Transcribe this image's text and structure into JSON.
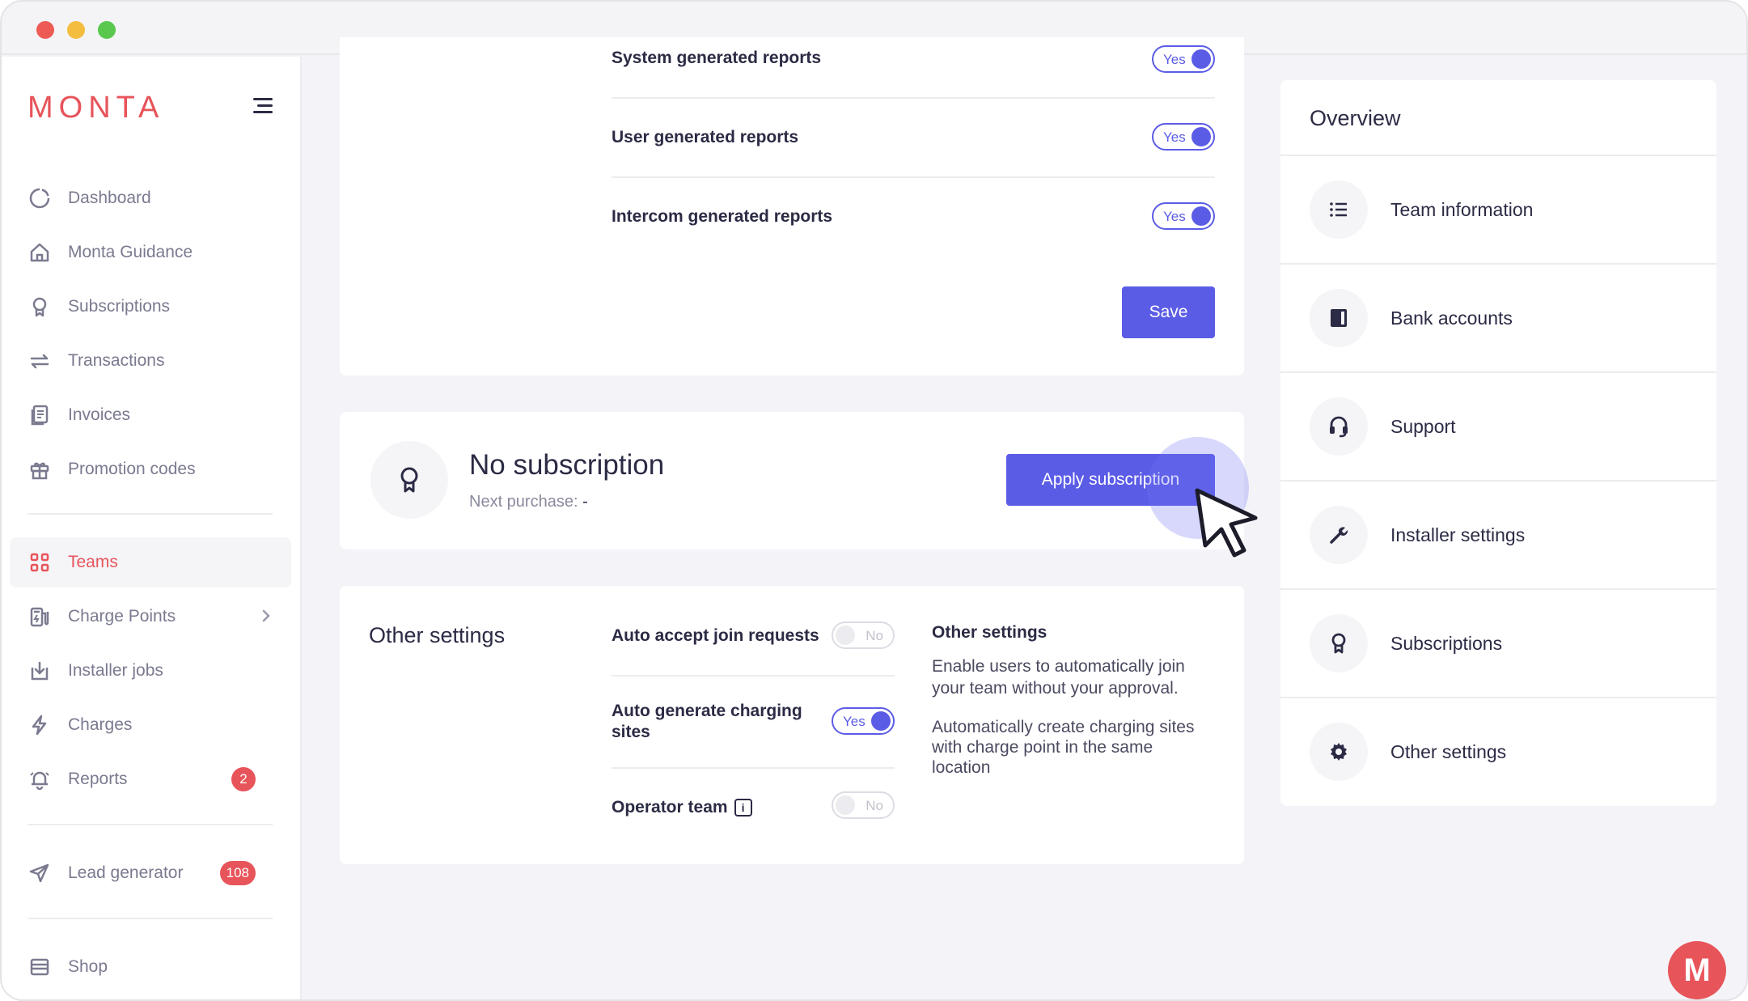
{
  "app": {
    "brand": "MONTA",
    "accent": "#e7545a",
    "primary": "#5b5ce6"
  },
  "sidebar": {
    "items": [
      {
        "label": "Dashboard",
        "icon": "dashboard-icon"
      },
      {
        "label": "Monta Guidance",
        "icon": "home-icon"
      },
      {
        "label": "Subscriptions",
        "icon": "badge-icon"
      },
      {
        "label": "Transactions",
        "icon": "arrows-icon"
      },
      {
        "label": "Invoices",
        "icon": "invoice-icon"
      },
      {
        "label": "Promotion codes",
        "icon": "gift-icon"
      },
      {
        "label": "Teams",
        "icon": "grid-icon",
        "active": true
      },
      {
        "label": "Charge Points",
        "icon": "charger-icon"
      },
      {
        "label": "Installer jobs",
        "icon": "download-icon"
      },
      {
        "label": "Charges",
        "icon": "bolt-icon"
      },
      {
        "label": "Reports",
        "icon": "bell-icon",
        "badge": "2"
      },
      {
        "label": "Lead generator",
        "icon": "send-icon",
        "badge": "108"
      },
      {
        "label": "Shop",
        "icon": "shop-icon"
      }
    ]
  },
  "reports": {
    "rows": [
      {
        "label": "System generated reports",
        "toggle": "Yes"
      },
      {
        "label": "User generated reports",
        "toggle": "Yes"
      },
      {
        "label": "Intercom generated reports",
        "toggle": "Yes"
      }
    ],
    "save_label": "Save"
  },
  "subscription": {
    "title": "No subscription",
    "next_purchase_label": "Next purchase:",
    "next_purchase_value": "-",
    "apply_label": "Apply subscription"
  },
  "other_settings": {
    "title": "Other settings",
    "rows": [
      {
        "label": "Auto accept join requests",
        "toggle": "No"
      },
      {
        "label_line1": "Auto generate charging",
        "label_line2": "sites",
        "toggle": "Yes"
      },
      {
        "label": "Operator team",
        "toggle": "No"
      }
    ],
    "help_title": "Other settings",
    "help_text_1_line1": "Enable users to automatically join",
    "help_text_1_line2": "your team without your approval.",
    "help_text_2_line1": "Automatically create charging sites",
    "help_text_2_line2": "with charge point in the same",
    "help_text_2_line3": "location"
  },
  "overview": {
    "title": "Overview",
    "items": [
      {
        "label": "Team information",
        "icon": "list-icon"
      },
      {
        "label": "Bank accounts",
        "icon": "book-icon"
      },
      {
        "label": "Support",
        "icon": "headset-icon"
      },
      {
        "label": "Installer settings",
        "icon": "wrench-icon"
      },
      {
        "label": "Subscriptions",
        "icon": "badge-icon"
      },
      {
        "label": "Other settings",
        "icon": "gear-icon"
      }
    ]
  },
  "chat": {
    "label": "M"
  }
}
